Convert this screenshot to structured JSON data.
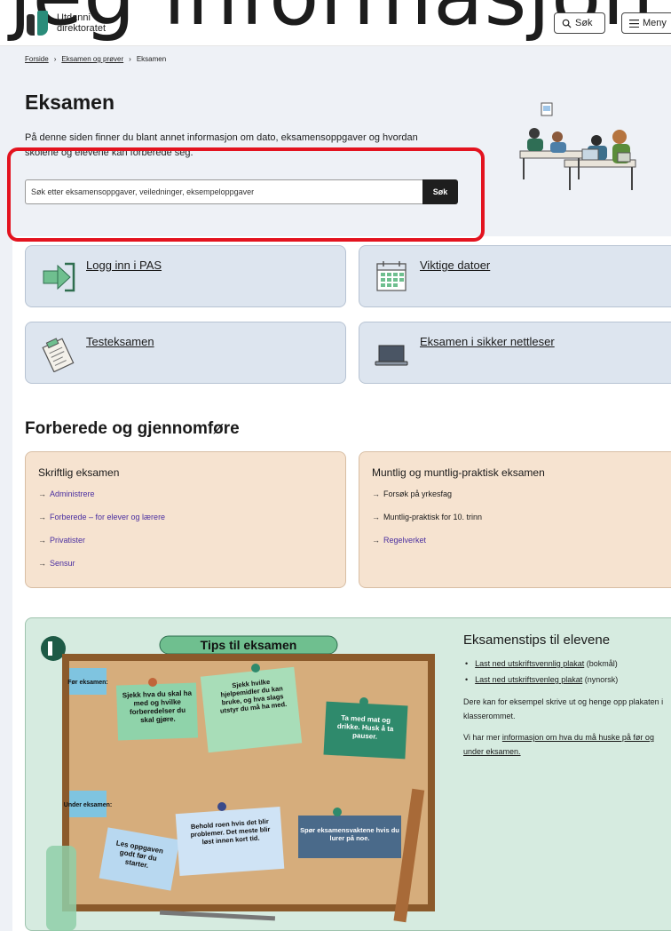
{
  "overlay": {
    "text": "jeg informasjon"
  },
  "header": {
    "logo_line1": "Utdanni",
    "logo_line2": "direktoratet",
    "search_label": "Søk",
    "menu_label": "Meny"
  },
  "breadcrumb": [
    "Forside",
    "Eksamen og prøver",
    "Eksamen"
  ],
  "hero": {
    "title": "Eksamen",
    "intro": "På denne siden finner du blant annet informasjon om dato, eksamensoppgaver og hvordan skolene og elevene kan forberede seg.",
    "search_placeholder": "Søk etter eksamensoppgaver, veiledninger, eksempeloppgaver",
    "search_button": "Søk"
  },
  "quick_links": [
    {
      "label": "Logg inn i PAS",
      "icon": "login-arrow-icon"
    },
    {
      "label": "Viktige datoer",
      "icon": "calendar-icon"
    },
    {
      "label": "Testeksamen",
      "icon": "clipboard-icon"
    },
    {
      "label": "Eksamen i sikker nettleser",
      "icon": "laptop-icon"
    }
  ],
  "section": {
    "title": "Forberede og gjennomføre"
  },
  "written": {
    "title": "Skriftlig eksamen",
    "items": [
      "Administrere",
      "Forberede – for elever og lærere",
      "Privatister",
      "Sensur"
    ]
  },
  "oral": {
    "title": "Muntlig og muntlig-praktisk eksamen",
    "items": [
      "Forsøk på yrkesfag",
      "Muntlig-praktisk for 10. trinn",
      "Regelverket"
    ]
  },
  "tips": {
    "board_title": "Tips til eksamen",
    "before_label": "Før eksamen:",
    "during_label": "Under eksamen:",
    "notes": [
      "Sjekk hva du skal ha med og hvilke forberedelser du skal gjøre.",
      "Sjekk hvilke hjelpemidler du kan bruke, og hva slags utstyr du må ha med.",
      "Ta med mat og drikke. Husk å ta pauser.",
      "Les oppgaven godt før du starter.",
      "Behold roen hvis det blir problemer. Det meste blir løst innen kort tid.",
      "Spør eksamensvaktene hvis du lurer på noe."
    ],
    "title": "Eksamenstips til elevene",
    "links": [
      {
        "link": "Last ned utskriftsvennlig plakat",
        "suffix": "(bokmål)"
      },
      {
        "link": "Last ned utskriftsvenleg plakat",
        "suffix": "(nynorsk)"
      }
    ],
    "para1": "Dere kan for eksempel skrive ut og henge opp plakaten i klasserommet.",
    "para2_prefix": "Vi har mer ",
    "para2_link": "informasjon om hva du må huske på før og under eksamen."
  },
  "colors": {
    "hero_bg": "#eef1f6",
    "quick_card_bg": "#dde5ef",
    "prepare_card_bg": "#f6e3d0",
    "tips_bg": "#d6ebe0",
    "annotation_red": "#e3131f",
    "link_purple": "#4a2fa0"
  }
}
